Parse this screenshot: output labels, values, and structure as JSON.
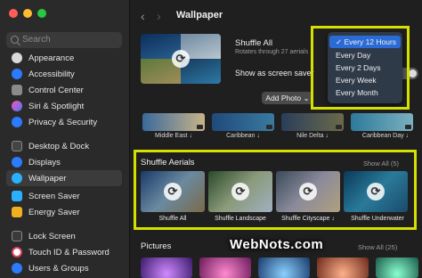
{
  "sidebar": {
    "search_placeholder": "Search",
    "items": [
      {
        "label": "Appearance",
        "color": "#6a6a6a"
      },
      {
        "label": "Accessibility",
        "color": "#2b7bff"
      },
      {
        "label": "Control Center",
        "color": "#8a8a8a"
      },
      {
        "label": "Siri & Spotlight",
        "color": "#d04bff"
      },
      {
        "label": "Privacy & Security",
        "color": "#2b7bff"
      },
      {
        "label": "Desktop & Dock",
        "color": "#3a3a3a"
      },
      {
        "label": "Displays",
        "color": "#2b7bff"
      },
      {
        "label": "Wallpaper",
        "color": "#2bb0ff"
      },
      {
        "label": "Screen Saver",
        "color": "#2bb0ff"
      },
      {
        "label": "Energy Saver",
        "color": "#f0b020"
      },
      {
        "label": "Lock Screen",
        "color": "#3a3a3a"
      },
      {
        "label": "Touch ID & Password",
        "color": "#e0405a"
      },
      {
        "label": "Users & Groups",
        "color": "#2b7bff"
      }
    ]
  },
  "toolbar": {
    "title": "Wallpaper",
    "back": "‹",
    "forward": "›"
  },
  "current": {
    "shuffle_label": "Shuffle All",
    "rotates_text": "Rotates through 27 aerials",
    "screensaver_label": "Show as screen saver",
    "add_photo": "Add Photo"
  },
  "dropdown": {
    "options": [
      "✓ Every 12 Hours",
      "Every Day",
      "Every 2 Days",
      "Every Week",
      "Every Month"
    ]
  },
  "landscapes": {
    "labels": [
      "Middle East ↓",
      "Caribbean ↓",
      "Nile Delta ↓",
      "Caribbean Day ↓"
    ]
  },
  "aerials": {
    "title": "Shuffle Aerials",
    "show_all": "Show All (5)",
    "items": [
      "Shuffle All",
      "Shuffle Landscape",
      "Shuffle Cityscape ↓",
      "Shuffle Underwater"
    ]
  },
  "pictures": {
    "title": "Pictures",
    "show_all": "Show All (25)"
  },
  "watermark": "WebNots.com",
  "colors": {
    "highlight": "#d6e000",
    "selected": "#2b6bd6"
  }
}
